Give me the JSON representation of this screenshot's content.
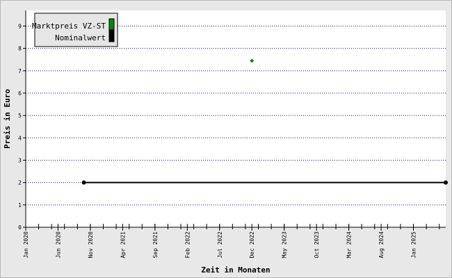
{
  "chart_data": {
    "type": "line",
    "xlabel": "Zeit in Monaten",
    "ylabel": "Preis in Euro",
    "x_range": [
      "2020-01",
      "2025-06"
    ],
    "ylim": [
      0,
      9.7
    ],
    "y_ticks": [
      0,
      1,
      2,
      3,
      4,
      5,
      6,
      7,
      8,
      9
    ],
    "x_ticks": [
      {
        "date": "2020-01",
        "label": "Jan 2020"
      },
      {
        "date": "2020-06",
        "label": "Jun 2020"
      },
      {
        "date": "2020-11",
        "label": "Nov 2020"
      },
      {
        "date": "2021-04",
        "label": "Apr 2021"
      },
      {
        "date": "2021-09",
        "label": "Sep 2021"
      },
      {
        "date": "2022-02",
        "label": "Feb 2022"
      },
      {
        "date": "2022-07",
        "label": "Jul 2022"
      },
      {
        "date": "2022-12",
        "label": "Dec 2022"
      },
      {
        "date": "2023-05",
        "label": "May 2023"
      },
      {
        "date": "2023-10",
        "label": "Oct 2023"
      },
      {
        "date": "2024-03",
        "label": "Mar 2024"
      },
      {
        "date": "2024-08",
        "label": "Aug 2024"
      },
      {
        "date": "2025-01",
        "label": "Jan 2025"
      }
    ],
    "grid": "horizontal dotted",
    "legend_position": "top-left",
    "series": [
      {
        "name": "Marktpreis VZ-ST",
        "color": "#008800",
        "style": "points",
        "points": [
          {
            "x": "2022-12",
            "y": 7.45
          }
        ]
      },
      {
        "name": "Nominalwert",
        "color": "#000000",
        "style": "line",
        "points": [
          {
            "x": "2020-10",
            "y": 2
          },
          {
            "x": "2025-06",
            "y": 2
          }
        ]
      }
    ]
  }
}
